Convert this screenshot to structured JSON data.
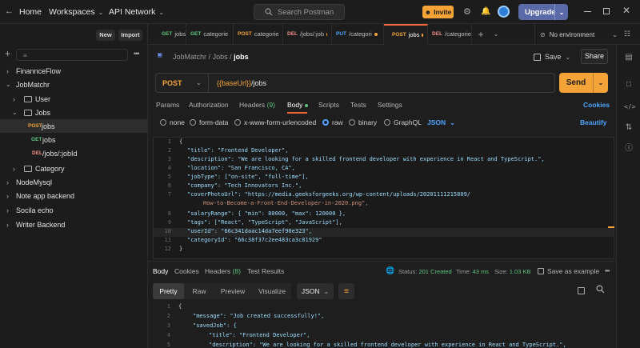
{
  "topbar": {
    "home": "Home",
    "workspaces": "Workspaces",
    "api_network": "API Network",
    "search_placeholder": "Search Postman",
    "invite": "Invite",
    "upgrade": "Upgrade"
  },
  "sidebar": {
    "new_label": "New",
    "import_label": "Import",
    "collections": [
      {
        "label": "FinannceFlow"
      },
      {
        "label": "JobMatchr"
      },
      {
        "label": "User"
      },
      {
        "label": "Jobs"
      },
      {
        "label": "Category"
      },
      {
        "label": "NodeMysql"
      },
      {
        "label": "Note app backend"
      },
      {
        "label": "Socila echo"
      },
      {
        "label": "Writer Backend"
      }
    ],
    "requests": [
      {
        "method": "POST",
        "label": "jobs"
      },
      {
        "method": "GET",
        "label": "jobs"
      },
      {
        "method": "DEL",
        "label": "/jobs/:jobId"
      }
    ]
  },
  "tabs": [
    {
      "method": "GET",
      "label": "jobs"
    },
    {
      "method": "GET",
      "label": "categorie"
    },
    {
      "method": "POST",
      "label": "categorie"
    },
    {
      "method": "DEL",
      "label": "/jobs/:job"
    },
    {
      "method": "PUT",
      "label": "/categori"
    },
    {
      "method": "POST",
      "label": "jobs"
    },
    {
      "method": "DEL",
      "label": "/categorie"
    }
  ],
  "environment": "No environment",
  "breadcrumb": {
    "collection": "JobMatchr",
    "folder": "Jobs",
    "request": "jobs"
  },
  "actions": {
    "save": "Save",
    "share": "Share"
  },
  "request": {
    "method": "POST",
    "url_var": "{{baseUrl}}",
    "url_path": "/jobs",
    "send": "Send"
  },
  "request_tabs": {
    "params": "Params",
    "authorization": "Authorization",
    "headers": "Headers",
    "headers_count": "(9)",
    "body": "Body",
    "scripts": "Scripts",
    "tests": "Tests",
    "settings": "Settings",
    "cookies": "Cookies"
  },
  "body_options": {
    "none": "none",
    "form_data": "form-data",
    "urlencoded": "x-www-form-urlencoded",
    "raw": "raw",
    "binary": "binary",
    "graphql": "GraphQL",
    "format": "JSON",
    "beautify": "Beautify"
  },
  "request_body": {
    "line_numbers": [
      "1",
      "2",
      "3",
      "4",
      "5",
      "6",
      "7",
      "",
      "8",
      "9",
      "10",
      "11",
      "12"
    ],
    "lines": [
      "{",
      "\"title\": \"Frontend Developer\",",
      "\"description\": \"We are looking for a skilled frontend developer with experience in React and TypeScript.\",",
      "\"location\": \"San Francisco, CA\",",
      "\"jobType\": [\"on-site\", \"full-time\"],",
      "\"company\": \"Tech Innovators Inc.\",",
      "\"coverPhotoUrl\": \"https://media.geeksforgeeks.org/wp-content/uploads/20201111215809/",
      "How-to-Become-a-Front-End-Developer-in-2020.png\",",
      "\"salaryRange\": { \"min\": 80000, \"max\": 120000 },",
      "\"tags\": [\"React\", \"TypeScript\", \"JavaScript\"],",
      "\"userId\": \"66c341daac14da7eef90e323\",",
      "\"categoryId\": \"66c38f37c2ee483ca3c81929\"",
      "}"
    ]
  },
  "response": {
    "tabs": {
      "body": "Body",
      "cookies": "Cookies",
      "headers": "Headers",
      "headers_count": "(8)",
      "test_results": "Test Results"
    },
    "status_label": "Status:",
    "status": "201 Created",
    "time_label": "Time:",
    "time": "43 ms",
    "size_label": "Size:",
    "size": "1.03 KB",
    "save_example": "Save as example",
    "views": {
      "pretty": "Pretty",
      "raw": "Raw",
      "preview": "Preview",
      "visualize": "Visualize",
      "format": "JSON"
    },
    "line_numbers": [
      "1",
      "2",
      "3",
      "4",
      "5"
    ],
    "lines": [
      "{",
      "\"message\": \"Job created successfully!\",",
      "\"savedJob\": {",
      "\"title\": \"Frontend Developer\",",
      "\"description\": \"We are looking for a skilled frontend developer with experience in React and TypeScript.\","
    ]
  }
}
